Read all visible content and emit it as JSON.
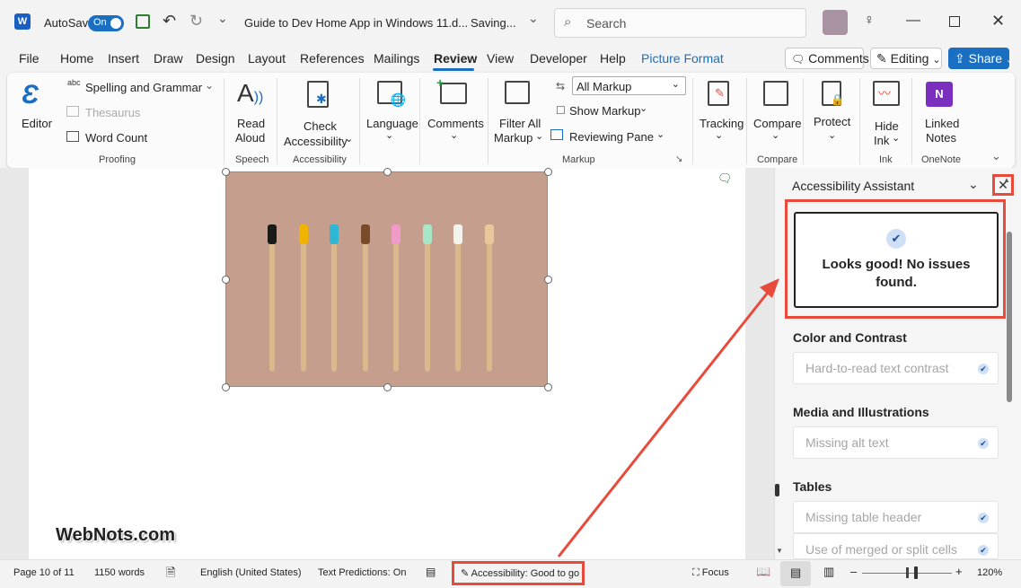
{
  "title_bar": {
    "autosave_label": "AutoSave",
    "autosave_state": "On",
    "document_title": "Guide to Dev Home App in Windows 11.d...",
    "save_status": "Saving...",
    "save_status_chevron": "⌄",
    "search_placeholder": "Search",
    "qat_more": "⌄"
  },
  "menu": {
    "tabs": [
      "File",
      "Home",
      "Insert",
      "Draw",
      "Design",
      "Layout",
      "References",
      "Mailings",
      "Review",
      "View",
      "Developer",
      "Help",
      "Picture Format"
    ],
    "active_tab": "Review",
    "comments_button": "Comments",
    "editing_button": "Editing",
    "share_button": "Share",
    "dropdown_caret": "⌄"
  },
  "ribbon": {
    "editor": "Editor",
    "spelling": "Spelling and Grammar",
    "spelling_abc": "abc",
    "thesaurus": "Thesaurus",
    "word_count": "Word Count",
    "proofing_group": "Proofing",
    "read_aloud_1": "Read",
    "read_aloud_2": "Aloud",
    "speech_group": "Speech",
    "check_acc_1": "Check",
    "check_acc_2": "Accessibility",
    "accessibility_group": "Accessibility",
    "language": "Language",
    "comments": "Comments",
    "filter_all_1": "Filter All",
    "filter_all_2": "Markup",
    "all_markup": "All Markup",
    "show_markup": "Show Markup",
    "reviewing_pane": "Reviewing Pane",
    "markup_group": "Markup",
    "tracking": "Tracking",
    "compare": "Compare",
    "compare_group": "Compare",
    "protect": "Protect",
    "hide_ink_1": "Hide",
    "hide_ink_2": "Ink",
    "ink_group": "Ink",
    "linked_notes_1": "Linked",
    "linked_notes_2": "Notes",
    "onenote_group": "OneNote",
    "chevron": "⌄"
  },
  "pane": {
    "title": "Accessibility Assistant",
    "result": "Looks good! No issues found.",
    "sections": [
      {
        "heading": "Color and Contrast",
        "items": [
          "Hard-to-read text contrast"
        ]
      },
      {
        "heading": "Media and Illustrations",
        "items": [
          "Missing alt text"
        ]
      },
      {
        "heading": "Tables",
        "items": [
          "Missing table header",
          "Use of merged or split cells"
        ]
      }
    ]
  },
  "status_bar": {
    "page": "Page 10 of 11",
    "words": "1150 words",
    "language": "English (United States)",
    "predictions": "Text Predictions: On",
    "accessibility": "Accessibility: Good to go",
    "focus": "Focus",
    "zoom_minus": "–",
    "zoom_plus": "+",
    "zoom": "120%",
    "zoom_percent": 0.6
  },
  "watermark": "WebNots.com",
  "colors": {
    "accent": "#1a6fc2",
    "highlight": "#e84b3c",
    "photo_bg": "#c59e8d"
  },
  "bristle_colors": [
    "#1a1a1a",
    "#f0b400",
    "#2fb7d6",
    "#7a4b2a",
    "#f09ac8",
    "#a8e6c8",
    "#f3f3ee",
    "#e8c79a"
  ]
}
